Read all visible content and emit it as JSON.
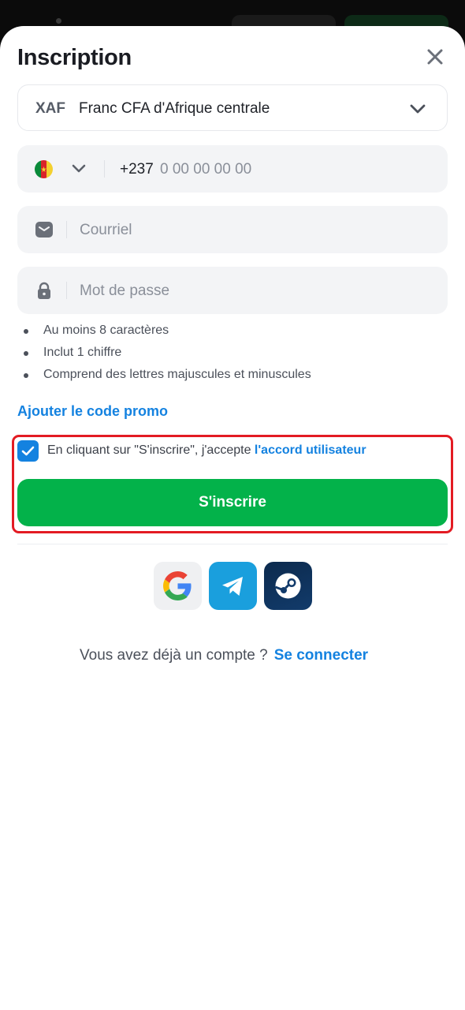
{
  "modal": {
    "title": "Inscription",
    "close_icon": "close-icon"
  },
  "currency": {
    "code": "XAF",
    "name": "Franc CFA d'Afrique centrale",
    "chevron_icon": "chevron-down-icon"
  },
  "phone": {
    "country_flag": "cameroon-flag-icon",
    "dial_code": "+237",
    "placeholder": "0 00 00 00 00"
  },
  "email": {
    "icon": "envelope-icon",
    "placeholder": "Courriel"
  },
  "password": {
    "icon": "lock-icon",
    "placeholder": "Mot de passe",
    "rules": [
      "Au moins 8 caractères",
      "Inclut 1 chiffre",
      "Comprend des lettres majuscules et minuscules"
    ]
  },
  "promo": {
    "label": "Ajouter le code promo"
  },
  "consent": {
    "checked": true,
    "text": "En cliquant sur \"S'inscrire\", j'accepte ",
    "link": "l'accord utilisateur"
  },
  "submit": {
    "label": "S'inscrire"
  },
  "social": [
    {
      "name": "google-icon"
    },
    {
      "name": "telegram-icon"
    },
    {
      "name": "steam-icon"
    }
  ],
  "login": {
    "prompt": "Vous avez déjà un compte ?",
    "link": "Se connecter"
  },
  "colors": {
    "accent_blue": "#1482e0",
    "primary_green": "#03b24a",
    "highlight_red": "#e31b23"
  }
}
